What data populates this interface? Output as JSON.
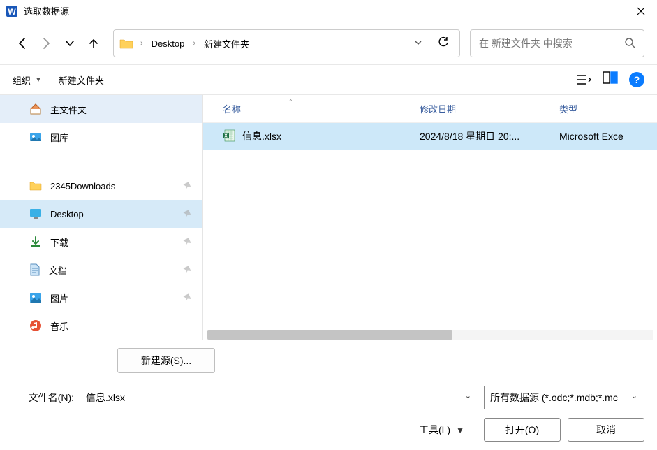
{
  "window": {
    "title": "选取数据源"
  },
  "nav": {
    "back": true,
    "forward": false
  },
  "breadcrumb": {
    "items": [
      "Desktop",
      "新建文件夹"
    ]
  },
  "search": {
    "placeholder": "在 新建文件夹 中搜索"
  },
  "toolbar": {
    "organize": "组织",
    "newfolder": "新建文件夹"
  },
  "sidebar": {
    "top": [
      {
        "label": "主文件夹",
        "icon": "home"
      },
      {
        "label": "图库",
        "icon": "gallery"
      }
    ],
    "quick": [
      {
        "label": "2345Downloads",
        "icon": "folder-y",
        "pinned": true
      },
      {
        "label": "Desktop",
        "icon": "desktop",
        "pinned": true,
        "active": true
      },
      {
        "label": "下载",
        "icon": "download",
        "pinned": true
      },
      {
        "label": "文档",
        "icon": "document",
        "pinned": true
      },
      {
        "label": "图片",
        "icon": "picture",
        "pinned": true
      },
      {
        "label": "音乐",
        "icon": "music",
        "pinned": false
      }
    ]
  },
  "filelist": {
    "headers": {
      "name": "名称",
      "date": "修改日期",
      "type": "类型"
    },
    "rows": [
      {
        "name": "信息.xlsx",
        "date": "2024/8/18 星期日 20:...",
        "type": "Microsoft Exce",
        "selected": true
      }
    ]
  },
  "bottom": {
    "newsource": "新建源(S)...",
    "filename_label": "文件名(N):",
    "filename_value": "信息.xlsx",
    "filter": "所有数据源 (*.odc;*.mdb;*.mc",
    "tools": "工具(L)",
    "open": "打开(O)",
    "cancel": "取消"
  }
}
